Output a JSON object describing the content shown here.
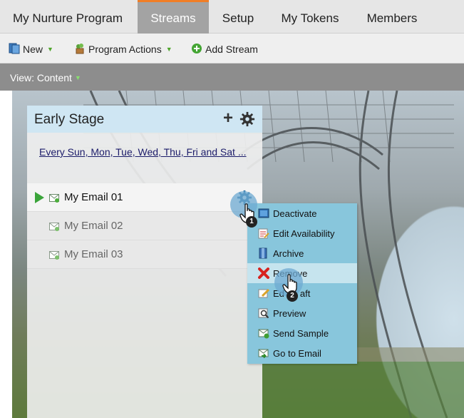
{
  "tabs": [
    {
      "label": "My Nurture Program",
      "active": false
    },
    {
      "label": "Streams",
      "active": true
    },
    {
      "label": "Setup",
      "active": false
    },
    {
      "label": "My Tokens",
      "active": false
    },
    {
      "label": "Members",
      "active": false
    }
  ],
  "toolbar": {
    "new_label": "New",
    "program_actions_label": "Program Actions",
    "add_stream_label": "Add Stream"
  },
  "view": {
    "label": "View: Content"
  },
  "stream": {
    "title": "Early Stage",
    "add_symbol": "+",
    "cadence": "Every Sun, Mon, Tue, Wed, Thu, Fri and Sat ...",
    "emails": [
      {
        "name": "My Email 01",
        "active": true
      },
      {
        "name": "My Email 02",
        "active": false
      },
      {
        "name": "My Email 03",
        "active": false
      }
    ]
  },
  "context_menu": {
    "items": [
      {
        "label": "Deactivate",
        "icon": "deactivate-icon"
      },
      {
        "label": "Edit Availability",
        "icon": "edit-availability-icon"
      },
      {
        "label": "Archive",
        "icon": "archive-icon"
      },
      {
        "label": "Remove",
        "icon": "remove-icon",
        "highlighted": true
      },
      {
        "label": "Edit Draft",
        "icon": "edit-draft-icon",
        "visible_text": "Ed",
        "visible_tail": "aft"
      },
      {
        "label": "Preview",
        "icon": "preview-icon"
      },
      {
        "label": "Send Sample",
        "icon": "send-sample-icon"
      },
      {
        "label": "Go to Email",
        "icon": "go-to-email-icon"
      }
    ]
  },
  "steps": {
    "step1": "1",
    "step2": "2"
  },
  "colors": {
    "tab_accent": "#f07e26",
    "menu_bg": "#88c6dc",
    "menu_highlight": "#c6e4ee",
    "panel_header": "#cfe6f3",
    "play_green": "#3aa43a"
  }
}
